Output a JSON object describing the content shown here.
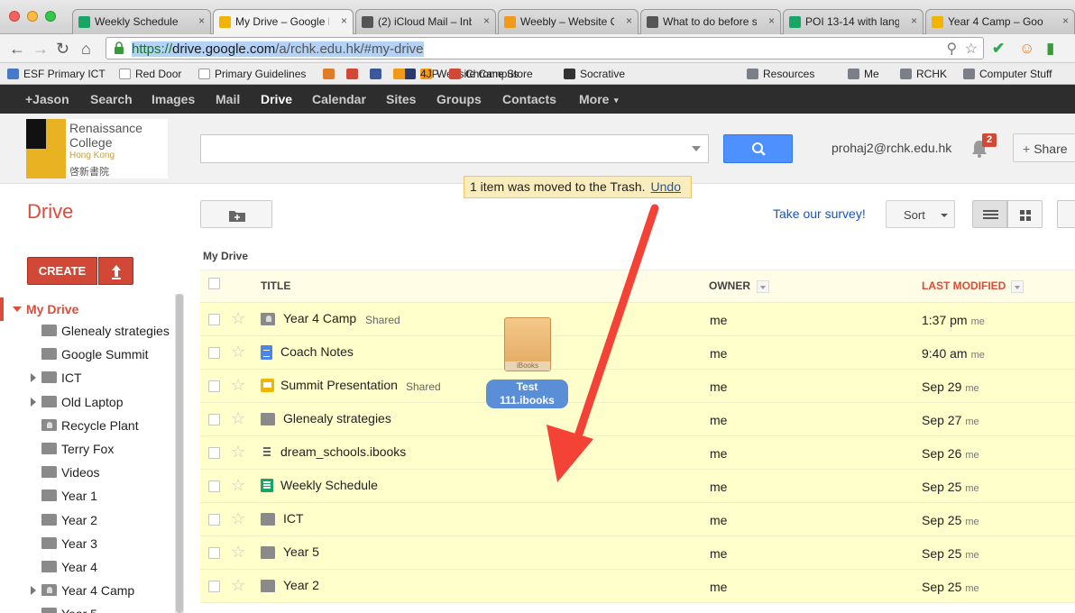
{
  "browser": {
    "tabs": [
      {
        "title": "Weekly Schedule",
        "icon": "sheets-icon",
        "color": "#16a765"
      },
      {
        "title": "My Drive – Google D",
        "icon": "drive-icon",
        "color": "#f1b400",
        "active": true
      },
      {
        "title": "(2) iCloud Mail – Inb",
        "icon": "apple-icon",
        "color": "#555555"
      },
      {
        "title": "Weebly – Website Cr",
        "icon": "weebly-icon",
        "color": "#f19a1a"
      },
      {
        "title": "What to do before s",
        "icon": "apple-icon",
        "color": "#555555"
      },
      {
        "title": "POI 13-14 with lang",
        "icon": "sheets-icon",
        "color": "#16a765"
      },
      {
        "title": "Year 4 Camp – Goo",
        "icon": "drive-icon",
        "color": "#f1b400"
      }
    ],
    "url": {
      "scheme": "https://",
      "host": "drive.google.com",
      "path": "/a/rchk.edu.hk/#my-drive"
    },
    "bookmarks": [
      {
        "label": "ESF Primary ICT",
        "icon": "bookmark-icon"
      },
      {
        "label": "Red Door",
        "icon": "page-icon"
      },
      {
        "label": "Primary Guidelines",
        "icon": "page-icon"
      },
      {
        "label": "Website Campus",
        "icon": "weebly-icon"
      },
      {
        "label": "4JP",
        "icon": "penguin-icon"
      },
      {
        "label": "Chrome Store",
        "icon": "chrome-store-icon"
      },
      {
        "label": "Socrative",
        "icon": "socrative-icon"
      },
      {
        "label": "Resources",
        "icon": "folder-icon"
      },
      {
        "label": "Me",
        "icon": "folder-icon"
      },
      {
        "label": "RCHK",
        "icon": "folder-icon"
      },
      {
        "label": "Computer Stuff",
        "icon": "folder-icon"
      }
    ]
  },
  "gbar": {
    "items": [
      "+Jason",
      "Search",
      "Images",
      "Mail",
      "Drive",
      "Calendar",
      "Sites",
      "Groups",
      "Contacts",
      "More"
    ],
    "active": "Drive"
  },
  "header": {
    "logo": {
      "line1": "Renaissance",
      "line2": "College",
      "line3": "Hong Kong",
      "line4": "啓新書院"
    },
    "search_placeholder": "",
    "user_email": "prohaj2@rchk.edu.hk",
    "notification_count": "2",
    "share_label": "Share"
  },
  "app": {
    "title": "Drive",
    "toast": {
      "message": "1 item was moved to the Trash.",
      "undo": "Undo"
    },
    "survey": "Take our survey!",
    "sort_label": "Sort",
    "create_label": "CREATE"
  },
  "sidebar": {
    "my_drive": "My Drive",
    "items": [
      {
        "label": "Glenealy strategies",
        "expandable": false,
        "shared": false
      },
      {
        "label": "Google Summit",
        "expandable": false,
        "shared": false
      },
      {
        "label": "ICT",
        "expandable": true,
        "shared": false
      },
      {
        "label": "Old Laptop",
        "expandable": true,
        "shared": false
      },
      {
        "label": "Recycle Plant",
        "expandable": false,
        "shared": true
      },
      {
        "label": "Terry Fox",
        "expandable": false,
        "shared": false
      },
      {
        "label": "Videos",
        "expandable": false,
        "shared": false
      },
      {
        "label": "Year 1",
        "expandable": false,
        "shared": false
      },
      {
        "label": "Year 2",
        "expandable": false,
        "shared": false
      },
      {
        "label": "Year 3",
        "expandable": false,
        "shared": false
      },
      {
        "label": "Year 4",
        "expandable": false,
        "shared": false
      },
      {
        "label": "Year 4 Camp",
        "expandable": true,
        "shared": true
      },
      {
        "label": "Year 5",
        "expandable": false,
        "shared": false
      }
    ]
  },
  "file_list": {
    "breadcrumb": "My Drive",
    "columns": {
      "title": "TITLE",
      "owner": "OWNER",
      "modified": "LAST MODIFIED"
    },
    "rows": [
      {
        "name": "Year 4 Camp",
        "type": "folder",
        "shared_icon": true,
        "shared_tag": "Shared",
        "owner": "me",
        "modified": "1:37 pm",
        "by": "me"
      },
      {
        "name": "Coach Notes",
        "type": "doc",
        "shared_icon": false,
        "shared_tag": "",
        "owner": "me",
        "modified": "9:40 am",
        "by": "me"
      },
      {
        "name": "Summit Presentation",
        "type": "slides",
        "shared_icon": false,
        "shared_tag": "Shared",
        "owner": "me",
        "modified": "Sep 29",
        "by": "me"
      },
      {
        "name": "Glenealy strategies",
        "type": "folder",
        "shared_icon": false,
        "shared_tag": "",
        "owner": "me",
        "modified": "Sep 27",
        "by": "me"
      },
      {
        "name": "dream_schools.ibooks",
        "type": "file",
        "shared_icon": false,
        "shared_tag": "",
        "owner": "me",
        "modified": "Sep 26",
        "by": "me"
      },
      {
        "name": "Weekly Schedule",
        "type": "sheet",
        "shared_icon": false,
        "shared_tag": "",
        "owner": "me",
        "modified": "Sep 25",
        "by": "me"
      },
      {
        "name": "ICT",
        "type": "folder",
        "shared_icon": false,
        "shared_tag": "",
        "owner": "me",
        "modified": "Sep 25",
        "by": "me"
      },
      {
        "name": "Year 5",
        "type": "folder",
        "shared_icon": false,
        "shared_tag": "",
        "owner": "me",
        "modified": "Sep 25",
        "by": "me"
      },
      {
        "name": "Year 2",
        "type": "folder",
        "shared_icon": false,
        "shared_tag": "",
        "owner": "me",
        "modified": "Sep 25",
        "by": "me"
      }
    ]
  },
  "drag": {
    "file_badge": "iBooks",
    "label_line1": "Test",
    "label_line2": "111.ibooks"
  },
  "colors": {
    "accent_red": "#dd4b39",
    "primary_blue": "#4d90fe",
    "row_highlight": "#ffffcc",
    "toast_bg": "#f9edbe",
    "annotation_arrow": "#f44336"
  }
}
